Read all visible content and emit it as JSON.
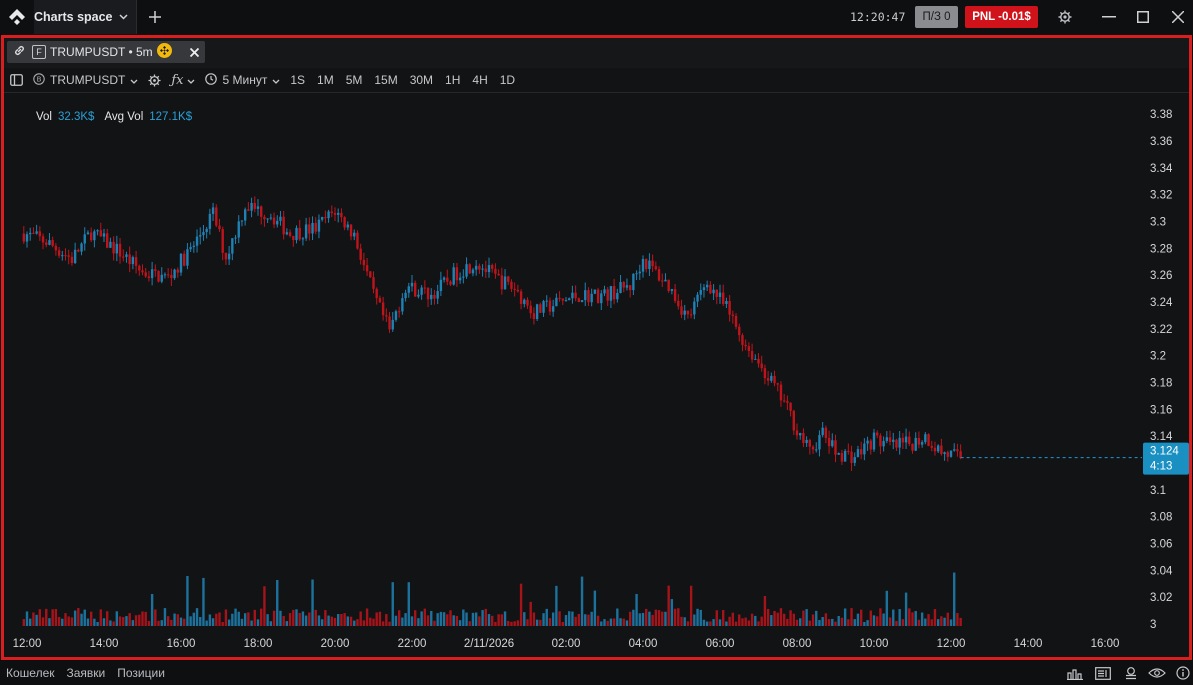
{
  "window": {
    "workspace_title": "Charts space",
    "clock": "12:20:47",
    "pz_badge": "П/З 0",
    "pnl_badge": "PNL -0.01$",
    "colors": {
      "pnl": "#d0121b",
      "accent": "#1a8fc2"
    }
  },
  "chart_tab": {
    "label": "TRUMPUSDT • 5m"
  },
  "toolbar": {
    "symbol": "TRUMPUSDT",
    "interval": "5 Минут",
    "timeframes": [
      "1S",
      "1M",
      "5M",
      "15M",
      "30M",
      "1H",
      "4H",
      "1D"
    ]
  },
  "indicators": {
    "vol_label": "Vol",
    "vol_value": "32.3K$",
    "avg_label": "Avg Vol",
    "avg_value": "127.1K$"
  },
  "price_tag": {
    "price": "3.124",
    "countdown": "4:13"
  },
  "chart_data": {
    "type": "candlestick",
    "symbol": "TRUMPUSDT",
    "interval": "5m",
    "y_ticks": [
      "3.38",
      "3.36",
      "3.34",
      "3.32",
      "3.3",
      "3.28",
      "3.26",
      "3.24",
      "3.22",
      "3.2",
      "3.18",
      "3.16",
      "3.14",
      "3.12",
      "3.1",
      "3.08",
      "3.06",
      "3.04",
      "3.02",
      "3"
    ],
    "ylim": [
      3.0,
      3.395
    ],
    "x_ticks": [
      "12:00",
      "14:00",
      "16:00",
      "18:00",
      "20:00",
      "22:00",
      "2/11/2026",
      "02:00",
      "04:00",
      "06:00",
      "08:00",
      "10:00",
      "12:00",
      "14:00",
      "16:00"
    ],
    "price_path": [
      [
        "11:55",
        3.291
      ],
      [
        "12:30",
        3.285
      ],
      [
        "13:10",
        3.272
      ],
      [
        "13:40",
        3.292
      ],
      [
        "14:20",
        3.279
      ],
      [
        "15:00",
        3.262
      ],
      [
        "15:40",
        3.258
      ],
      [
        "16:20",
        3.282
      ],
      [
        "16:50",
        3.306
      ],
      [
        "17:10",
        3.273
      ],
      [
        "17:40",
        3.312
      ],
      [
        "18:20",
        3.305
      ],
      [
        "18:50",
        3.291
      ],
      [
        "19:30",
        3.295
      ],
      [
        "20:00",
        3.308
      ],
      [
        "20:30",
        3.29
      ],
      [
        "21:00",
        3.245
      ],
      [
        "21:25",
        3.218
      ],
      [
        "21:50",
        3.252
      ],
      [
        "22:30",
        3.245
      ],
      [
        "23:10",
        3.262
      ],
      [
        "23:40",
        3.27
      ],
      [
        "00:10",
        3.258
      ],
      [
        "00:40",
        3.25
      ],
      [
        "01:10",
        3.232
      ],
      [
        "01:40",
        3.238
      ],
      [
        "02:20",
        3.245
      ],
      [
        "03:00",
        3.245
      ],
      [
        "03:40",
        3.252
      ],
      [
        "04:00",
        3.272
      ],
      [
        "04:40",
        3.252
      ],
      [
        "05:10",
        3.228
      ],
      [
        "05:40",
        3.255
      ],
      [
        "06:10",
        3.235
      ],
      [
        "06:40",
        3.208
      ],
      [
        "07:10",
        3.188
      ],
      [
        "07:40",
        3.165
      ],
      [
        "08:00",
        3.145
      ],
      [
        "08:20",
        3.128
      ],
      [
        "08:40",
        3.142
      ],
      [
        "09:00",
        3.128
      ],
      [
        "09:30",
        3.125
      ],
      [
        "10:00",
        3.138
      ],
      [
        "10:30",
        3.132
      ],
      [
        "11:00",
        3.135
      ],
      [
        "11:20",
        3.14
      ],
      [
        "11:45",
        3.128
      ],
      [
        "12:15",
        3.124
      ]
    ]
  },
  "statusbar": {
    "tabs": [
      "Кошелек",
      "Заявки",
      "Позиции"
    ]
  }
}
